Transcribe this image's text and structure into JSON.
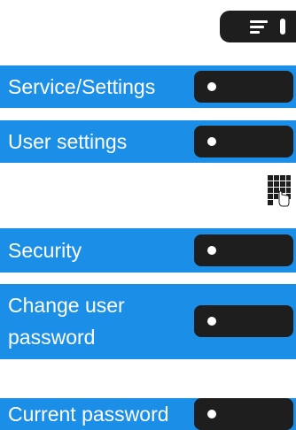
{
  "menu_rows": [
    {
      "label": "Service/Settings"
    },
    {
      "label": "User settings"
    },
    {
      "label": "Security"
    },
    {
      "label": "Change user password"
    },
    {
      "label": "Current password"
    }
  ],
  "icons": {
    "top_button": "menu-lines-icon",
    "row_key": "dot-icon",
    "keypad": "keypad-touch-icon"
  },
  "colors": {
    "row_background": "#1b8fe8",
    "key_background": "#1e1e1e",
    "text": "#ffffff"
  }
}
